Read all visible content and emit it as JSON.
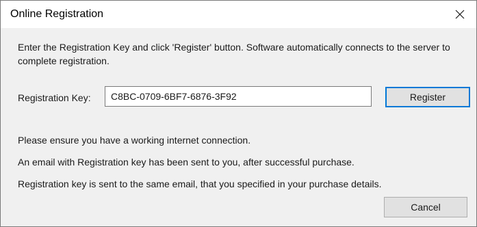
{
  "window": {
    "title": "Online Registration"
  },
  "instructions": "Enter the Registration Key and click 'Register' button. Software automatically connects to the server to complete registration.",
  "registration": {
    "label": "Registration Key:",
    "key_value": "C8BC-0709-6BF7-6876-3F92",
    "register_label": "Register"
  },
  "info": [
    "Please ensure you have a working internet connection.",
    "An email with Registration key has been sent to you, after successful purchase.",
    "Registration key is sent to the same email, that you specified in your purchase details."
  ],
  "footer": {
    "cancel_label": "Cancel"
  },
  "icons": {
    "close": "close-icon"
  },
  "colors": {
    "focus_border": "#0078d7",
    "button_face": "#e1e1e1",
    "dialog_background": "#f0f0f0"
  }
}
